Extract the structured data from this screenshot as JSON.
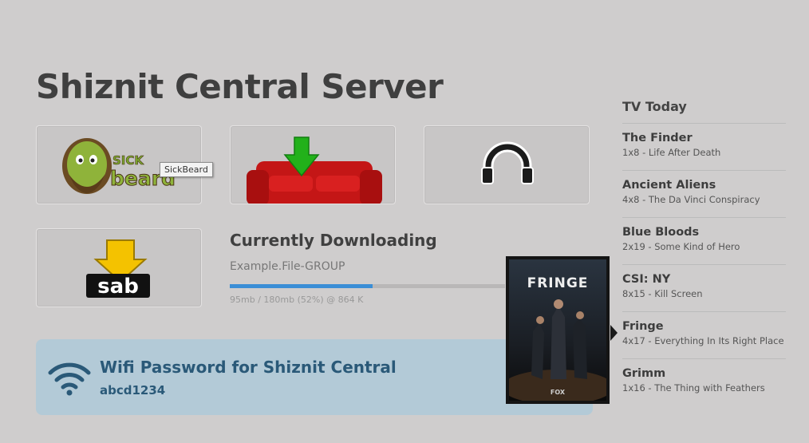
{
  "page": {
    "title": "Shiznit Central Server"
  },
  "apps": [
    {
      "name": "SickBeard",
      "logo_text_top": "SICK",
      "logo_text_bottom": "beard"
    },
    {
      "name": "CouchPotato"
    },
    {
      "name": "Headphones"
    },
    {
      "name": "SABnzbd",
      "logo_text": "sab"
    }
  ],
  "tooltip": {
    "text": "SickBeard"
  },
  "download": {
    "heading": "Currently Downloading",
    "filename": "Example.File-GROUP",
    "progress": 0.52,
    "stats": "95mb / 180mb (52%) @ 864 K"
  },
  "wifi": {
    "title": "Wifi Password for Shiznit Central",
    "password": "abcd1234"
  },
  "poster": {
    "title": "FRINGE",
    "network": "FOX"
  },
  "tv_today": {
    "title": "TV Today",
    "shows": [
      {
        "name": "The Finder",
        "episode": "1x8 - Life After Death"
      },
      {
        "name": "Ancient Aliens",
        "episode": "4x8 - The Da Vinci Conspiracy"
      },
      {
        "name": "Blue Bloods",
        "episode": "2x19 - Some Kind of Hero"
      },
      {
        "name": "CSI: NY",
        "episode": "8x15 - Kill Screen"
      },
      {
        "name": "Fringe",
        "episode": "4x17 - Everything In Its Right Place"
      },
      {
        "name": "Grimm",
        "episode": "1x16 - The Thing with Feathers"
      }
    ]
  },
  "colors": {
    "accent": "#3b8ed6",
    "wifi_text": "#2a5978",
    "wifi_bg": "#b3cad7"
  }
}
